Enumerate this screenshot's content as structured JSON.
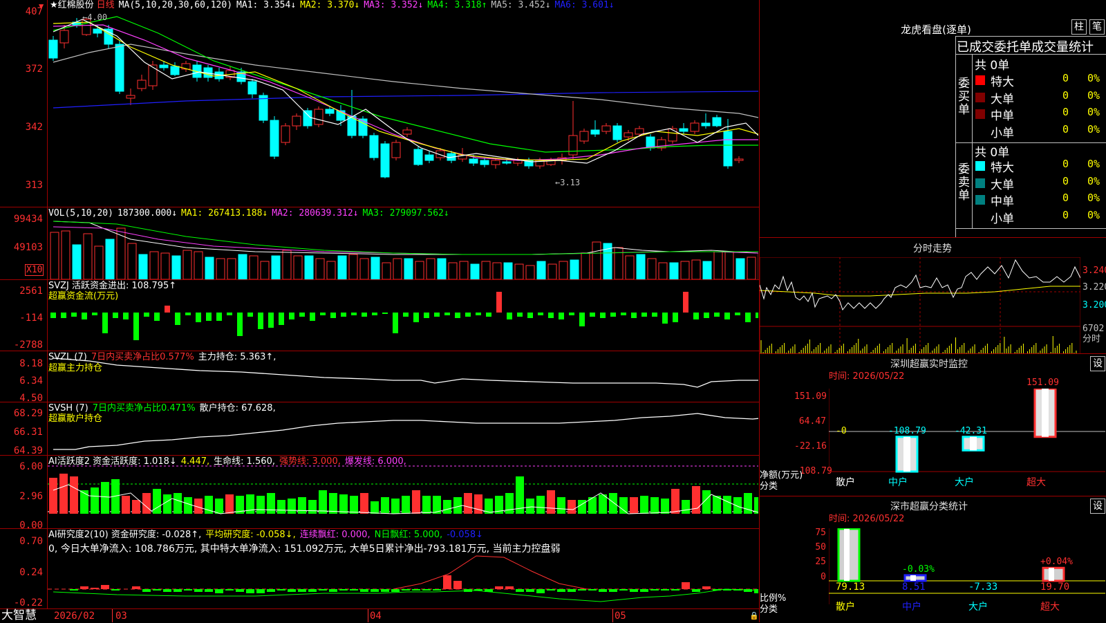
{
  "main": {
    "title": "★红棉股份",
    "period": "日线",
    "ma_header": "MA(5,10,20,30,60,120)",
    "ma1": "MA1: 3.354↓",
    "ma2": "MA2: 3.370↓",
    "ma3": "MA3: 3.352↓",
    "ma4": "MA4: 3.318↑",
    "ma5": "MA5: 3.452↓",
    "ma6": "MA6: 3.601↓",
    "high_label": "←4.00",
    "low_label": "←3.13",
    "y_ticks": [
      "407",
      "372",
      "342",
      "313"
    ]
  },
  "vol": {
    "header": "VOL(5,10,20)",
    "value": "187300.000↓",
    "ma1": "MA1: 267413.188↓",
    "ma2": "MA2: 280639.312↓",
    "ma3": "MA3: 279097.562↓",
    "y_ticks": [
      "99434",
      "49103"
    ],
    "unit": "X10"
  },
  "svzj": {
    "header": "SVZJ  活跃资金进出: 108.795↑",
    "sub": "超赢资金流(万元)",
    "y_ticks": [
      "2561",
      "-114",
      "-2788"
    ]
  },
  "svzl": {
    "header_a": "SVZL (7)",
    "header_b": "7日内买卖净占比0.577%",
    "header_c": "主力持仓: 5.363↑,",
    "sub": "超赢主力持仓",
    "y_ticks": [
      "8.18",
      "6.34",
      "4.50"
    ]
  },
  "svsh": {
    "header_a": "SVSH (7)",
    "header_b": "7日内买卖净占比0.471%",
    "header_c": "散户持仓: 67.628,",
    "sub": "超赢散户持仓",
    "y_ticks": [
      "68.29",
      "66.31",
      "64.39"
    ]
  },
  "ai1": {
    "header_a": "AI活跃度2 资金活跃度: 1.018↓",
    "header_b": "4.447,",
    "header_c": "生命线: 1.560,",
    "header_d": "强势线: 3.000,",
    "header_e": "爆发线: 6.000,",
    "y_ticks": [
      "6.00",
      "2.96",
      "0.00"
    ]
  },
  "ai2": {
    "header_a": "AI研究度2(10) 资金研究度: -0.028↑,",
    "header_b": "平均研究度: -0.058↓,",
    "header_c": "连续飘红: 0.000,",
    "header_d": "N日飘红: 5.000,",
    "header_e": "-0.058↓",
    "line2": "0, 今日大单净流入: 108.786万元, 其中特大单净流入: 151.092万元, 大单5日累计净出-793.181万元, 当前主力控盘弱",
    "y_ticks": [
      "0.70",
      "0.24",
      "-0.22"
    ]
  },
  "xaxis": {
    "brand": "大智慧",
    "labels": [
      "2026/02",
      "03",
      "04",
      "05"
    ]
  },
  "lhb": {
    "title": "龙虎看盘(逐单)",
    "btn_col": "柱",
    "btn_pen": "笔",
    "header": "已成交委托单成交量统计",
    "buy_side": "委买单",
    "sell_side": "委卖单",
    "buy_total": "共 0单",
    "sell_total": "共 0单",
    "rows_buy": [
      {
        "name": "特大",
        "count": "0",
        "pct": "0%"
      },
      {
        "name": "大单",
        "count": "0",
        "pct": "0%"
      },
      {
        "name": "中单",
        "count": "0",
        "pct": "0%"
      },
      {
        "name": "小单",
        "count": "0",
        "pct": "0%"
      }
    ],
    "rows_sell": [
      {
        "name": "特大",
        "count": "0",
        "pct": "0%"
      },
      {
        "name": "大单",
        "count": "0",
        "pct": "0%"
      },
      {
        "name": "中单",
        "count": "0",
        "pct": "0%"
      },
      {
        "name": "小单",
        "count": "0",
        "pct": "0%"
      }
    ]
  },
  "fenshi": {
    "title": "分时走势",
    "y_ticks": [
      "3.240",
      "3.220",
      "3.200"
    ],
    "vol_tick": "6702",
    "vol_label": "分时"
  },
  "sz_monitor": {
    "title": "深圳超赢实时监控",
    "btn": "设",
    "date": "时间: 2026/05/22",
    "y_ticks": [
      "151.09",
      "64.47",
      "-22.16",
      "-108.79"
    ],
    "ylabel": "净额(万元)",
    "xlabel": "分类",
    "categories": [
      "散户",
      "中户",
      "大户",
      "超大"
    ],
    "values": [
      "-0",
      "-108.79",
      "-42.31",
      "151.09"
    ]
  },
  "sz_class": {
    "title": "深市超赢分类统计",
    "btn": "设",
    "date": "时间: 2026/05/22",
    "y_ticks": [
      "75",
      "50",
      "25",
      "0"
    ],
    "ylabel": "比例%",
    "xlabel": "分类",
    "categories": [
      "散户",
      "中户",
      "大户",
      "超大"
    ],
    "top_values": [
      "",
      "-0.03%",
      "",
      "+0.04%"
    ],
    "bottom_values": [
      "79.13",
      "8.51",
      "-7.33",
      "19.70"
    ]
  }
}
